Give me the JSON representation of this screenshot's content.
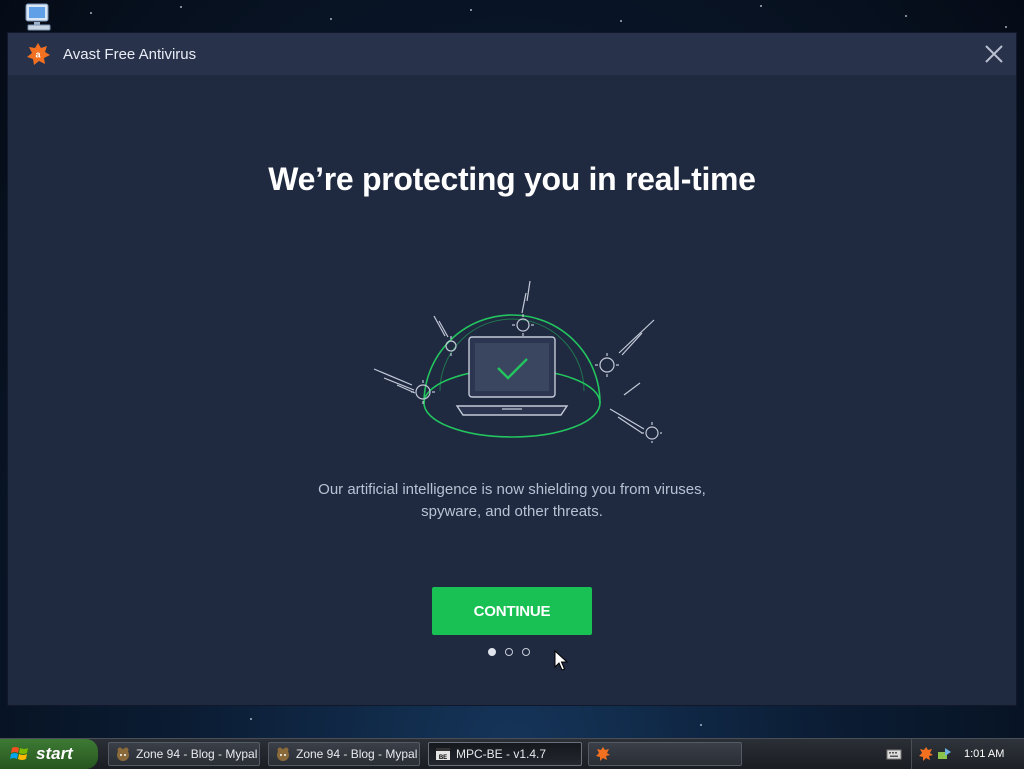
{
  "window": {
    "title": "Avast Free Antivirus",
    "close_label": "×"
  },
  "content": {
    "headline": "We’re protecting you in real-time",
    "description_line1": "Our artificial intelligence is now shielding you from viruses,",
    "description_line2": "spyware, and other threats.",
    "continue_label": "CONTINUE",
    "pager": {
      "total": 3,
      "current": 1
    },
    "illustration": "laptop-under-shield-dome-with-viruses"
  },
  "taskbar": {
    "start_label": "start",
    "tasks": [
      {
        "label": "Zone 94 - Blog - Mypal",
        "icon": "mypal-icon",
        "active": false
      },
      {
        "label": "Zone 94 - Blog - Mypal",
        "icon": "mypal-icon",
        "active": false
      },
      {
        "label": "MPC-BE - v1.4.7",
        "icon": "mpc-be-icon",
        "active": true
      },
      {
        "label": "",
        "icon": "avast-icon",
        "active": false
      }
    ],
    "clock": "1:01 AM"
  },
  "colors": {
    "accent_green": "#19c054",
    "window_bg": "#1f2940",
    "titlebar_bg": "#28324b",
    "avast_orange": "#f37021"
  }
}
